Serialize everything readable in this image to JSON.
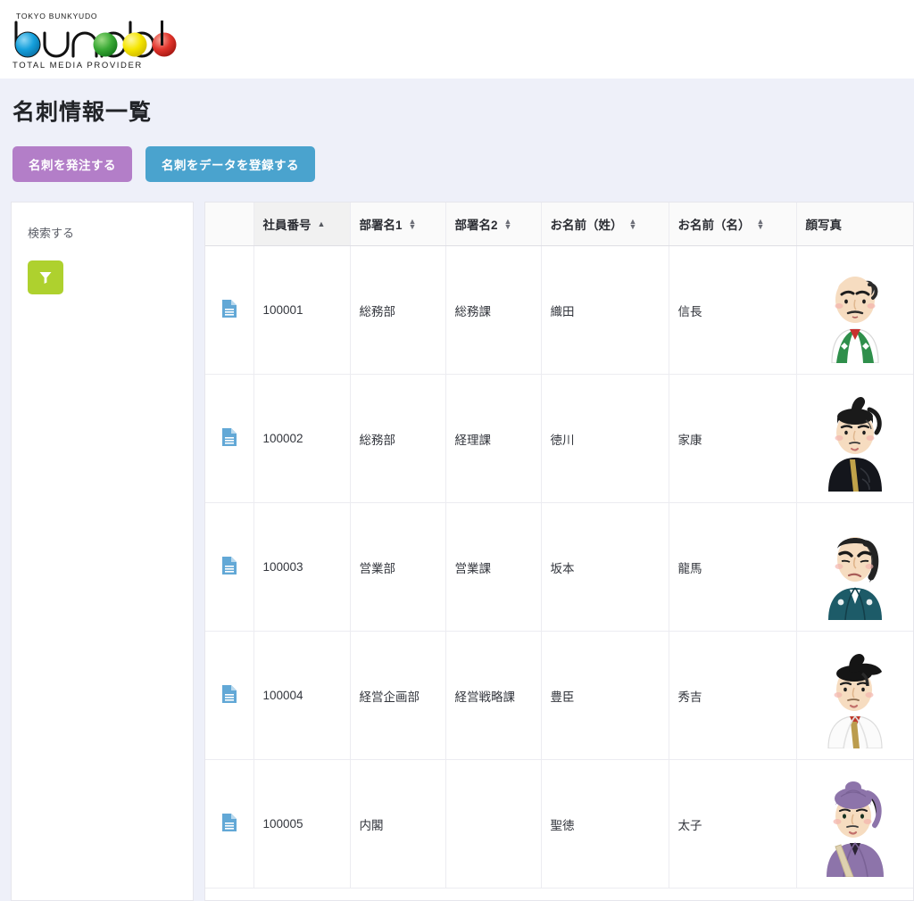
{
  "brand": {
    "tagline_top": "TOKYO BUNKYUDO",
    "wordmark": "bunpdo",
    "tagline_bottom": "TOTAL MEDIA PROVIDER",
    "circle_colors": [
      "#1a9fd9",
      "#3aaa35",
      "#f5e500",
      "#e2342b"
    ]
  },
  "header": {
    "title": "名刺情報一覧",
    "order_button": "名刺を発注する",
    "register_button": "名刺をデータを登録する",
    "order_color": "#b37ec8",
    "register_color": "#4aa3ce"
  },
  "sidebar": {
    "search_label": "検索する",
    "filter_icon": "filter-funnel-icon",
    "filter_color": "#aed12e"
  },
  "table": {
    "columns": [
      {
        "key": "icon",
        "label": "",
        "sortable": false,
        "sort": "none"
      },
      {
        "key": "num",
        "label": "社員番号",
        "sortable": true,
        "sort": "asc"
      },
      {
        "key": "dept1",
        "label": "部署名1",
        "sortable": true,
        "sort": "none"
      },
      {
        "key": "dept2",
        "label": "部署名2",
        "sortable": true,
        "sort": "none"
      },
      {
        "key": "last",
        "label": "お名前（姓）",
        "sortable": true,
        "sort": "none"
      },
      {
        "key": "first",
        "label": "お名前（名）",
        "sortable": true,
        "sort": "none"
      },
      {
        "key": "photo",
        "label": "顔写真",
        "sortable": false,
        "sort": "none"
      }
    ],
    "rows": [
      {
        "icon": "document-icon",
        "num": "100001",
        "dept1": "総務部",
        "dept2": "総務課",
        "last": "織田",
        "first": "信長",
        "photo": "oda-nobunaga-avatar"
      },
      {
        "icon": "document-icon",
        "num": "100002",
        "dept1": "総務部",
        "dept2": "経理課",
        "last": "徳川",
        "first": "家康",
        "photo": "tokugawa-ieyasu-avatar"
      },
      {
        "icon": "document-icon",
        "num": "100003",
        "dept1": "営業部",
        "dept2": "営業課",
        "last": "坂本",
        "first": "龍馬",
        "photo": "sakamoto-ryoma-avatar"
      },
      {
        "icon": "document-icon",
        "num": "100004",
        "dept1": "経営企画部",
        "dept2": "経営戦略課",
        "last": "豊臣",
        "first": "秀吉",
        "photo": "toyotomi-hideyoshi-avatar"
      },
      {
        "icon": "document-icon",
        "num": "100005",
        "dept1": "内閣",
        "dept2": "",
        "last": "聖徳",
        "first": "太子",
        "photo": "shotoku-taishi-avatar"
      }
    ]
  },
  "colors": {
    "page_background": "#eef0f9",
    "card_background": "#ffffff",
    "doc_icon": "#62a8d6"
  }
}
